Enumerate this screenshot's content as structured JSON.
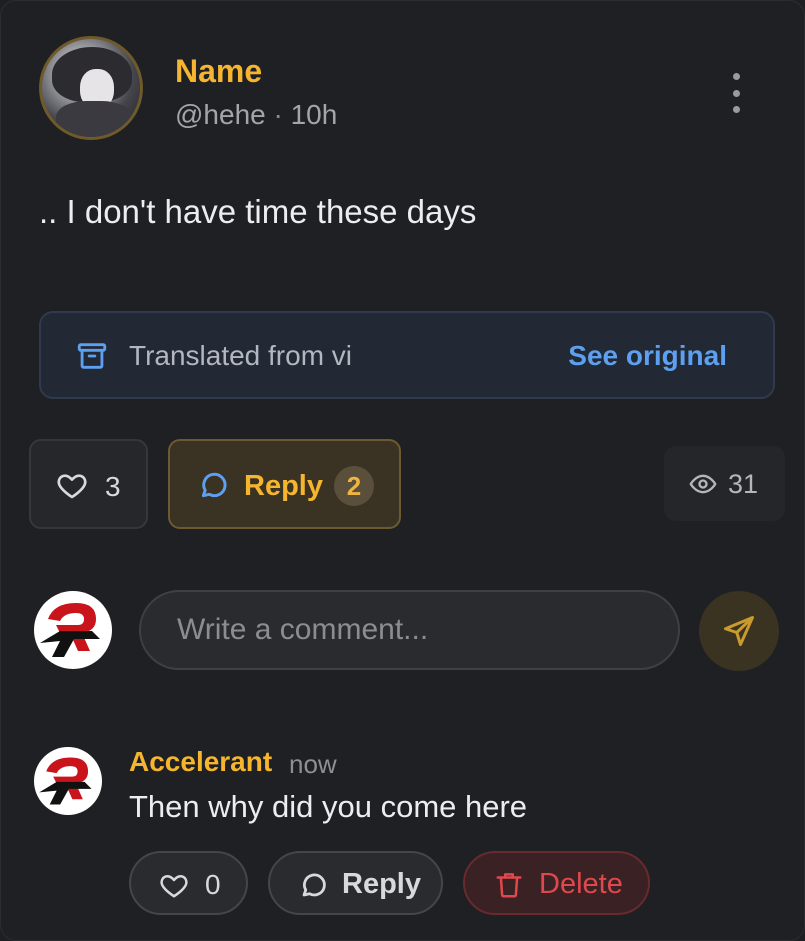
{
  "post": {
    "author_name": "Name",
    "handle": "@hehe",
    "separator": "·",
    "time": "10h",
    "text": ".. I don't have time these days",
    "translation": {
      "text": "Translated from vi",
      "action": "See original",
      "icon": "archive-box-icon"
    },
    "likes": "3",
    "reply_label": "Reply",
    "reply_count": "2",
    "views": "31"
  },
  "composer": {
    "placeholder": "Write a comment...",
    "send_icon": "send-icon"
  },
  "comments": [
    {
      "author": "Accelerant",
      "time": "now",
      "text": "Then why did you come here",
      "likes": "0",
      "reply_label": "Reply",
      "delete_label": "Delete"
    }
  ],
  "colors": {
    "accent": "#f5b52e",
    "link": "#5ea0f0",
    "danger": "#e0484d",
    "background": "#1f2023"
  }
}
